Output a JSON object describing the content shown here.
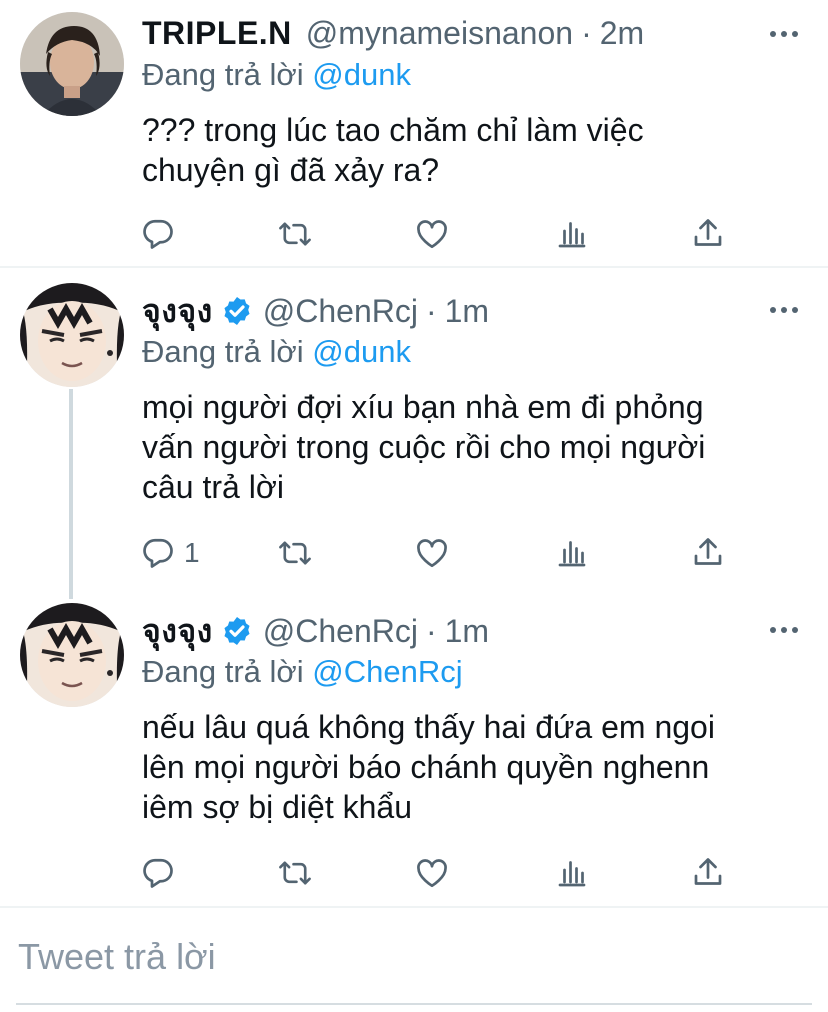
{
  "tweets": [
    {
      "name": "TRIPLE.N",
      "verified": false,
      "handle": "@mynameisnanon",
      "dot": "·",
      "time": "2m",
      "replying_prefix": "Đang trả lời",
      "replying_to": "@dunk",
      "lines": [
        "??? trong lúc tao chăm chỉ làm việc",
        "chuyện gì đã xảy ra?"
      ],
      "reply_count": ""
    },
    {
      "name": "จุงจุง",
      "verified": true,
      "handle": "@ChenRcj",
      "dot": "·",
      "time": "1m",
      "replying_prefix": "Đang trả lời",
      "replying_to": "@dunk",
      "lines": [
        "mọi người đợi xíu bạn nhà em đi phỏng",
        "vấn người trong cuộc rồi cho mọi người",
        "câu trả lời"
      ],
      "reply_count": "1"
    },
    {
      "name": "จุงจุง",
      "verified": true,
      "handle": "@ChenRcj",
      "dot": "·",
      "time": "1m",
      "replying_prefix": "Đang trả lời",
      "replying_to": "@ChenRcj",
      "lines": [
        "nếu lâu quá không thấy hai đứa em ngoi",
        "lên mọi người báo chánh quyền nghenn",
        "iêm sợ bị diệt khẩu"
      ],
      "reply_count": ""
    }
  ],
  "composer": {
    "placeholder": "Tweet trả lời"
  },
  "colors": {
    "accent": "#1d9bf0",
    "secondary_text": "#536471",
    "divider": "#eff3f4"
  },
  "icons": [
    "reply-icon",
    "retweet-icon",
    "like-icon",
    "analytics-icon",
    "share-icon",
    "more-icon",
    "verified-badge-icon"
  ]
}
